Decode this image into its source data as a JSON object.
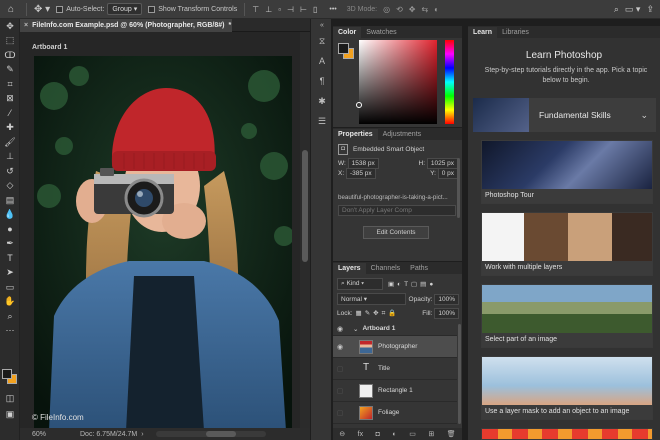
{
  "options_bar": {
    "auto_select_label": "Auto-Select:",
    "auto_select_value": "Group",
    "transform_controls_label": "Show Transform Controls",
    "mode_3d_label": "3D Mode:"
  },
  "document": {
    "tab_title": "FileInfo.com Example.psd @ 60% (Photographer, RGB/8#)",
    "tab_modified": "*",
    "artboard_label": "Artboard 1",
    "watermark": "© FileInfo.com",
    "zoom": "60%",
    "doc_size": "Doc: 6.75M/24.7M"
  },
  "color_panel": {
    "tabs": [
      "Color",
      "Swatches"
    ],
    "foreground": "#1a1a1a",
    "background": "#f2a11f"
  },
  "properties_panel": {
    "tabs": [
      "Properties",
      "Adjustments"
    ],
    "object_type": "Embedded Smart Object",
    "w_label": "W:",
    "w_value": "1538 px",
    "h_label": "H:",
    "h_value": "1025 px",
    "x_label": "X:",
    "x_value": "-385 px",
    "y_label": "Y:",
    "y_value": "0 px",
    "filename": "beautiful-photographer-is-taking-a-pict...",
    "layer_comp": "Don't Apply Layer Comp",
    "edit_button": "Edit Contents"
  },
  "layers_panel": {
    "tabs": [
      "Layers",
      "Channels",
      "Paths"
    ],
    "filter": "Kind",
    "blend_mode": "Normal",
    "opacity_label": "Opacity:",
    "opacity_value": "100%",
    "lock_label": "Lock:",
    "fill_label": "Fill:",
    "fill_value": "100%",
    "layers": [
      {
        "name": "Artboard 1",
        "kind": "group"
      },
      {
        "name": "Photographer",
        "kind": "smart"
      },
      {
        "name": "Title",
        "kind": "text"
      },
      {
        "name": "Rectangle 1",
        "kind": "shape"
      },
      {
        "name": "Foliage",
        "kind": "image"
      }
    ]
  },
  "learn_panel": {
    "tabs": [
      "Learn",
      "Libraries"
    ],
    "heading": "Learn Photoshop",
    "subtitle": "Step-by-step tutorials directly in the app. Pick a topic below to begin.",
    "section": "Fundamental Skills",
    "tutorials": [
      "Photoshop Tour",
      "Work with multiple layers",
      "Select part of an image",
      "Use a layer mask to add an object to an image"
    ]
  },
  "colors": {
    "accent_orange": "#f2a11f",
    "hat_red": "#c0262b",
    "jacket_blue": "#3d6795"
  }
}
